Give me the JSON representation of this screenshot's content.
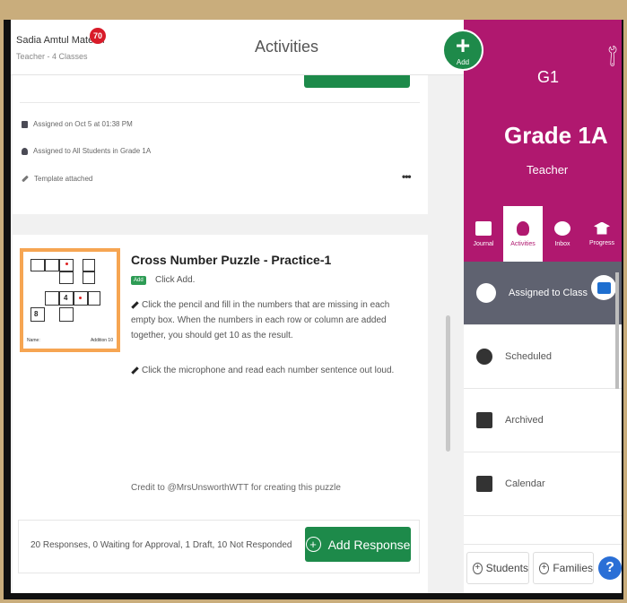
{
  "header": {
    "user_name": "Sadia Amtul Mateen",
    "notification_count": "70",
    "user_role": "Teacher - 4 Classes",
    "title": "Activities"
  },
  "previous_activity": {
    "assigned_on": "Assigned on Oct 5 at 01:38 PM",
    "assigned_to": "Assigned to All Students in Grade 1A",
    "template": "Template attached",
    "more": "•••"
  },
  "activity": {
    "title": "Cross Number Puzzle - Practice-1",
    "add_tag": "Add",
    "click_add": "Click Add.",
    "instruction_1": "Click the pencil and fill in the numbers that are missing in each empty box. When the numbers in each row or column are added together, you should get 10 as the result.",
    "instruction_2": "Click the microphone and read each number sentence out loud.",
    "credit": "Credit to @MrsUnsworthWTT for creating this puzzle",
    "thumbnail": {
      "numbers": [
        "4",
        "8"
      ],
      "caption_left": "Name:",
      "caption_right": "Addition 10"
    },
    "responses_summary": "20 Responses, 0 Waiting for Approval, 1 Draft, 10 Not Responded",
    "add_response_label": "Add Response"
  },
  "fab": {
    "label": "Add",
    "plus": "+"
  },
  "class_panel": {
    "code": "G1",
    "name": "Grade 1A",
    "role": "Teacher",
    "tabs": [
      {
        "label": "Journal",
        "active": false
      },
      {
        "label": "Activities",
        "active": true
      },
      {
        "label": "Inbox",
        "active": false
      },
      {
        "label": "Progress",
        "active": false
      }
    ],
    "items": [
      {
        "label": "Assigned to Class",
        "icon": "lightbulb-icon",
        "active": true
      },
      {
        "label": "Scheduled",
        "icon": "clock-icon",
        "active": false
      },
      {
        "label": "Archived",
        "icon": "archive-icon",
        "active": false
      },
      {
        "label": "Calendar",
        "icon": "calendar-icon",
        "active": false
      }
    ],
    "bottom": {
      "students": "Students",
      "families": "Families",
      "help": "?"
    }
  },
  "colors": {
    "accent_magenta": "#b0186f",
    "primary_green": "#1d8a4a",
    "active_item_gray": "#5f6270",
    "help_blue": "#2a6fd6",
    "badge_red": "#d81b29"
  }
}
